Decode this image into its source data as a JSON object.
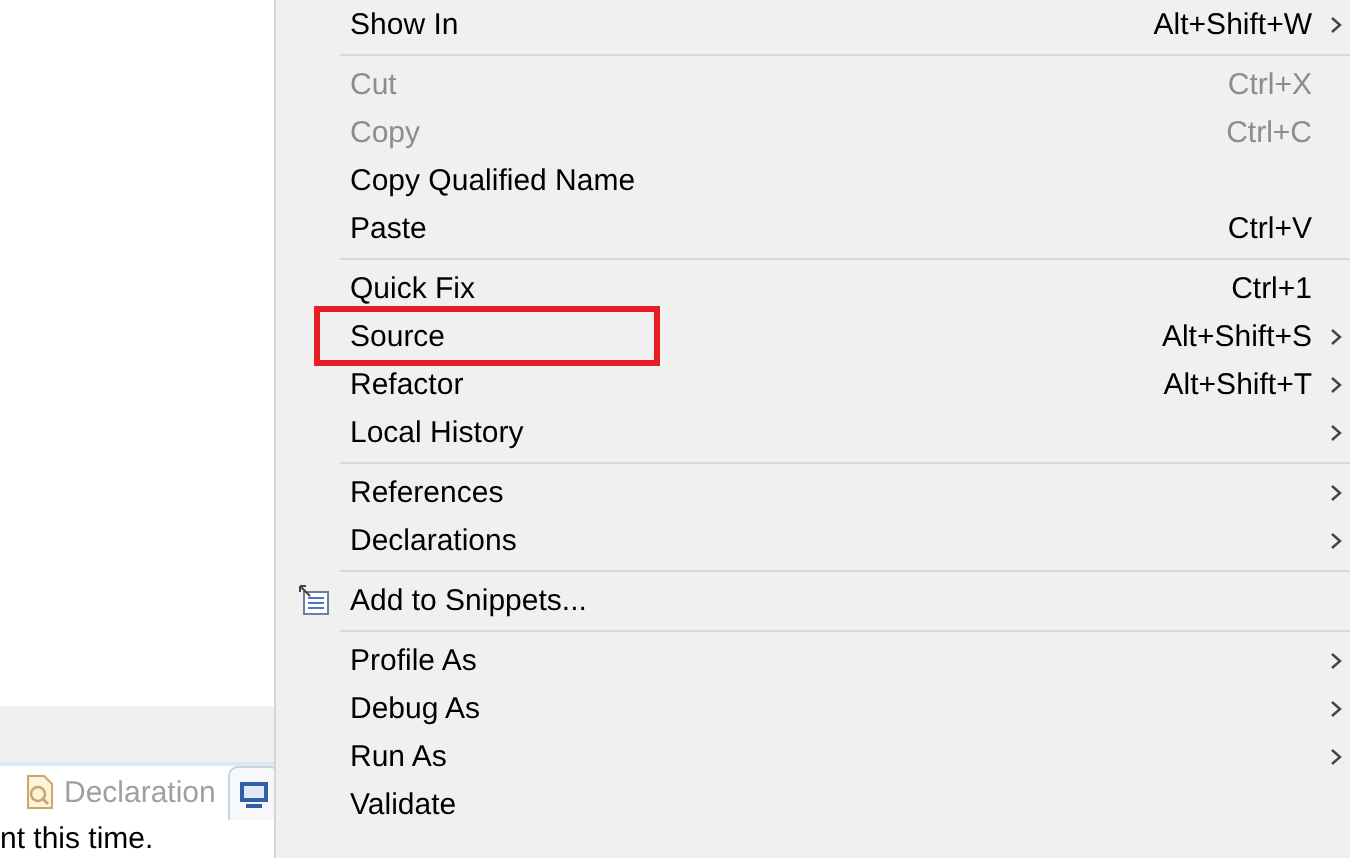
{
  "background_view": {
    "tabs": [
      {
        "label": "Declaration",
        "selected": false
      },
      {
        "selected": true
      }
    ],
    "console_text": "nt this time."
  },
  "context_menu": {
    "items": [
      {
        "kind": "item",
        "label": "Show In",
        "shortcut": "Alt+Shift+W",
        "disabled": false,
        "submenu": true
      },
      {
        "kind": "separator"
      },
      {
        "kind": "item",
        "label": "Cut",
        "shortcut": "Ctrl+X",
        "disabled": true,
        "submenu": false
      },
      {
        "kind": "item",
        "label": "Copy",
        "shortcut": "Ctrl+C",
        "disabled": true,
        "submenu": false
      },
      {
        "kind": "item",
        "label": "Copy Qualified Name",
        "disabled": false,
        "submenu": false
      },
      {
        "kind": "item",
        "label": "Paste",
        "shortcut": "Ctrl+V",
        "disabled": false,
        "submenu": false
      },
      {
        "kind": "separator"
      },
      {
        "kind": "item",
        "label": "Quick Fix",
        "shortcut": "Ctrl+1",
        "disabled": false,
        "submenu": false
      },
      {
        "kind": "item",
        "label": "Source",
        "shortcut": "Alt+Shift+S",
        "disabled": false,
        "submenu": true,
        "highlighted": true
      },
      {
        "kind": "item",
        "label": "Refactor",
        "shortcut": "Alt+Shift+T",
        "disabled": false,
        "submenu": true
      },
      {
        "kind": "item",
        "label": "Local History",
        "disabled": false,
        "submenu": true
      },
      {
        "kind": "separator"
      },
      {
        "kind": "item",
        "label": "References",
        "disabled": false,
        "submenu": true
      },
      {
        "kind": "item",
        "label": "Declarations",
        "disabled": false,
        "submenu": true
      },
      {
        "kind": "separator"
      },
      {
        "kind": "icon_item",
        "label": "Add to Snippets...",
        "disabled": false,
        "submenu": false
      },
      {
        "kind": "separator"
      },
      {
        "kind": "item",
        "label": "Profile As",
        "disabled": false,
        "submenu": true
      },
      {
        "kind": "item",
        "label": "Debug As",
        "disabled": false,
        "submenu": true
      },
      {
        "kind": "item",
        "label": "Run As",
        "disabled": false,
        "submenu": true
      },
      {
        "kind": "item",
        "label": "Validate",
        "disabled": false,
        "submenu": false
      }
    ]
  }
}
